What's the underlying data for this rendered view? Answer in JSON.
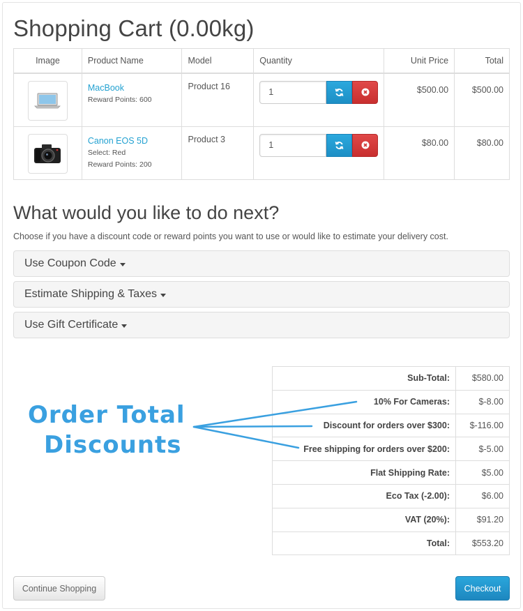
{
  "page_title": "Shopping Cart  (0.00kg)",
  "cart": {
    "headers": {
      "image": "Image",
      "name": "Product Name",
      "model": "Model",
      "quantity": "Quantity",
      "unit_price": "Unit Price",
      "total": "Total"
    },
    "rows": [
      {
        "image_icon": "laptop-icon",
        "name": "MacBook",
        "options": [
          "Reward Points: 600"
        ],
        "model": "Product 16",
        "quantity": "1",
        "unit_price": "$500.00",
        "total": "$500.00"
      },
      {
        "image_icon": "camera-icon",
        "name": "Canon EOS 5D",
        "options": [
          "Select: Red",
          "Reward Points: 200"
        ],
        "model": "Product 3",
        "quantity": "1",
        "unit_price": "$80.00",
        "total": "$80.00"
      }
    ]
  },
  "next": {
    "title": "What would you like to do next?",
    "description": "Choose if you have a discount code or reward points you want to use or would like to estimate your delivery cost.",
    "panels": [
      {
        "label": "Use Coupon Code"
      },
      {
        "label": "Estimate Shipping & Taxes"
      },
      {
        "label": "Use Gift Certificate"
      }
    ]
  },
  "totals": [
    {
      "label": "Sub-Total:",
      "value": "$580.00"
    },
    {
      "label": "10% For Cameras:",
      "value": "$-8.00"
    },
    {
      "label": "Discount for orders over $300:",
      "value": "$-116.00"
    },
    {
      "label": "Free shipping for orders over $200:",
      "value": "$-5.00"
    },
    {
      "label": "Flat Shipping Rate:",
      "value": "$5.00"
    },
    {
      "label": "Eco Tax (-2.00):",
      "value": "$6.00"
    },
    {
      "label": "VAT (20%):",
      "value": "$91.20"
    },
    {
      "label": "Total:",
      "value": "$553.20"
    }
  ],
  "annotation": {
    "line1": "Order Total",
    "line2": "Discounts"
  },
  "buttons": {
    "continue": "Continue Shopping",
    "checkout": "Checkout"
  },
  "colors": {
    "link": "#23a1d1",
    "primary": "#229ac8",
    "danger": "#da4f49",
    "annotation": "#3aa0e0"
  }
}
